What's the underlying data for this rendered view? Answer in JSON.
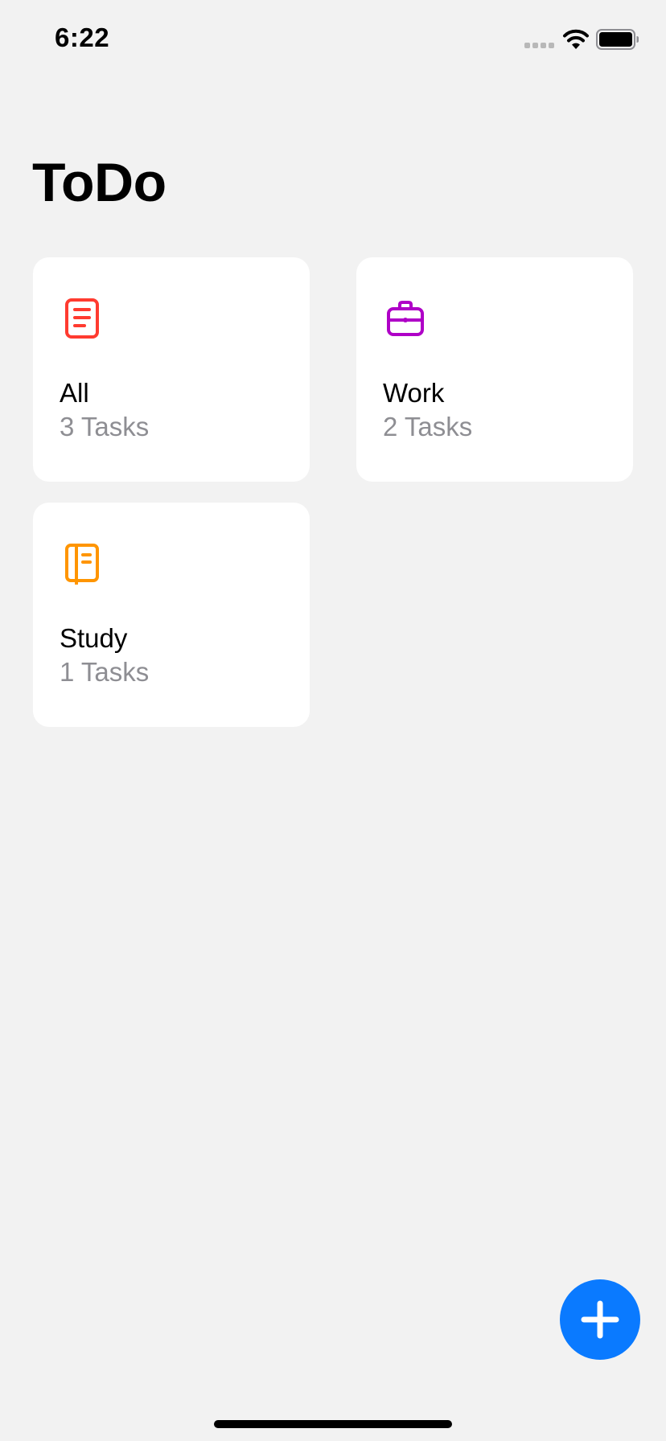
{
  "status_bar": {
    "time": "6:22",
    "icons": [
      "signal-icon",
      "wifi-icon",
      "battery-icon"
    ]
  },
  "header": {
    "title": "ToDo"
  },
  "categories": [
    {
      "name": "All",
      "count": "3 Tasks",
      "icon": "document-icon",
      "color": "#ff3b30"
    },
    {
      "name": "Work",
      "count": "2 Tasks",
      "icon": "briefcase-icon",
      "color": "#af00c7"
    },
    {
      "name": "Study",
      "count": "1 Tasks",
      "icon": "notebook-icon",
      "color": "#ff9500"
    }
  ],
  "fab": {
    "icon": "plus-icon",
    "color": "#0a7aff"
  }
}
